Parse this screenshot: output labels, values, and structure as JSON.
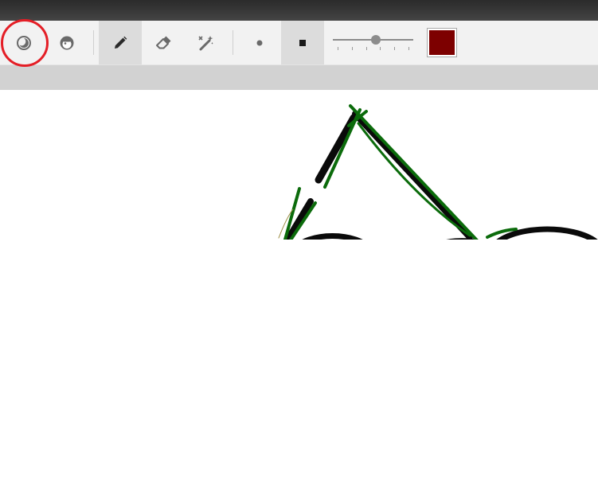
{
  "toolbar": {
    "tools": [
      {
        "name": "theme-toggle",
        "icon": "half-moon-circle-icon",
        "active": false
      },
      {
        "name": "face-tool",
        "icon": "face-icon",
        "active": false
      },
      {
        "name": "pencil-tool",
        "icon": "pencil-icon",
        "active": true
      },
      {
        "name": "eraser-tool",
        "icon": "eraser-icon",
        "active": false
      },
      {
        "name": "magic-wand-tool",
        "icon": "magic-wand-icon",
        "active": false
      },
      {
        "name": "round-brush",
        "icon": "dot-icon",
        "active": false
      },
      {
        "name": "square-brush",
        "icon": "square-icon",
        "active": true
      }
    ],
    "brush_size_fraction": 0.53,
    "brush_color": "#7d0000"
  },
  "colors": {
    "highlight": "#e41e26",
    "stroke_black": "#0a0a0a",
    "stroke_green": "#0b6b0b"
  }
}
